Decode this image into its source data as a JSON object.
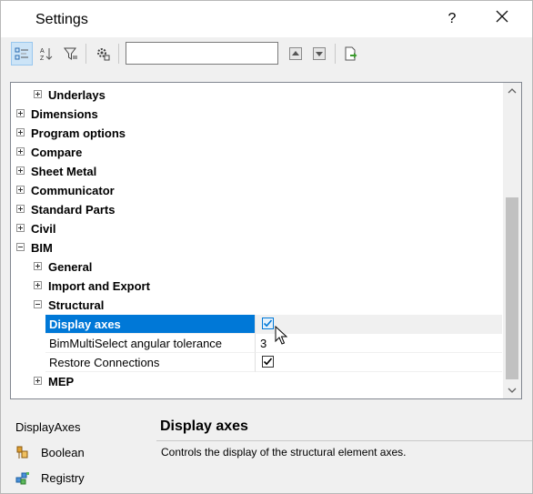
{
  "window": {
    "title": "Settings",
    "help_label": "?"
  },
  "toolbar": {
    "buttons": [
      "categorized-view",
      "alphabetical-view",
      "filter",
      "settings-options",
      "move-up",
      "move-down",
      "export"
    ],
    "search": {
      "value": "",
      "placeholder": ""
    }
  },
  "tree": {
    "items": [
      {
        "label": "Underlays",
        "expanded": false
      },
      {
        "label": "Dimensions",
        "expanded": false
      },
      {
        "label": "Program options",
        "expanded": false
      },
      {
        "label": "Compare",
        "expanded": false
      },
      {
        "label": "Sheet Metal",
        "expanded": false
      },
      {
        "label": "Communicator",
        "expanded": false
      },
      {
        "label": "Standard Parts",
        "expanded": false
      },
      {
        "label": "Civil",
        "expanded": false
      },
      {
        "label": "BIM",
        "expanded": true
      },
      {
        "label": "General",
        "expanded": false
      },
      {
        "label": "Import and Export",
        "expanded": false
      },
      {
        "label": "Structural",
        "expanded": true
      },
      {
        "label": "MEP",
        "expanded": false
      }
    ],
    "properties": [
      {
        "name": "Display axes",
        "value": "",
        "checked": true,
        "selected": true
      },
      {
        "name": "BimMultiSelect angular tolerance",
        "value": "3",
        "selected": false
      },
      {
        "name": "Restore Connections",
        "value": "",
        "checked": true,
        "selected": false
      }
    ]
  },
  "bottom": {
    "variable_name": "DisplayAxes",
    "type_label": "Boolean",
    "storage_label": "Registry",
    "desc_title": "Display axes",
    "desc_text": "Controls the display of the structural element axes."
  },
  "colors": {
    "selection": "#0078d7",
    "accent_green": "#3a9b2c"
  }
}
